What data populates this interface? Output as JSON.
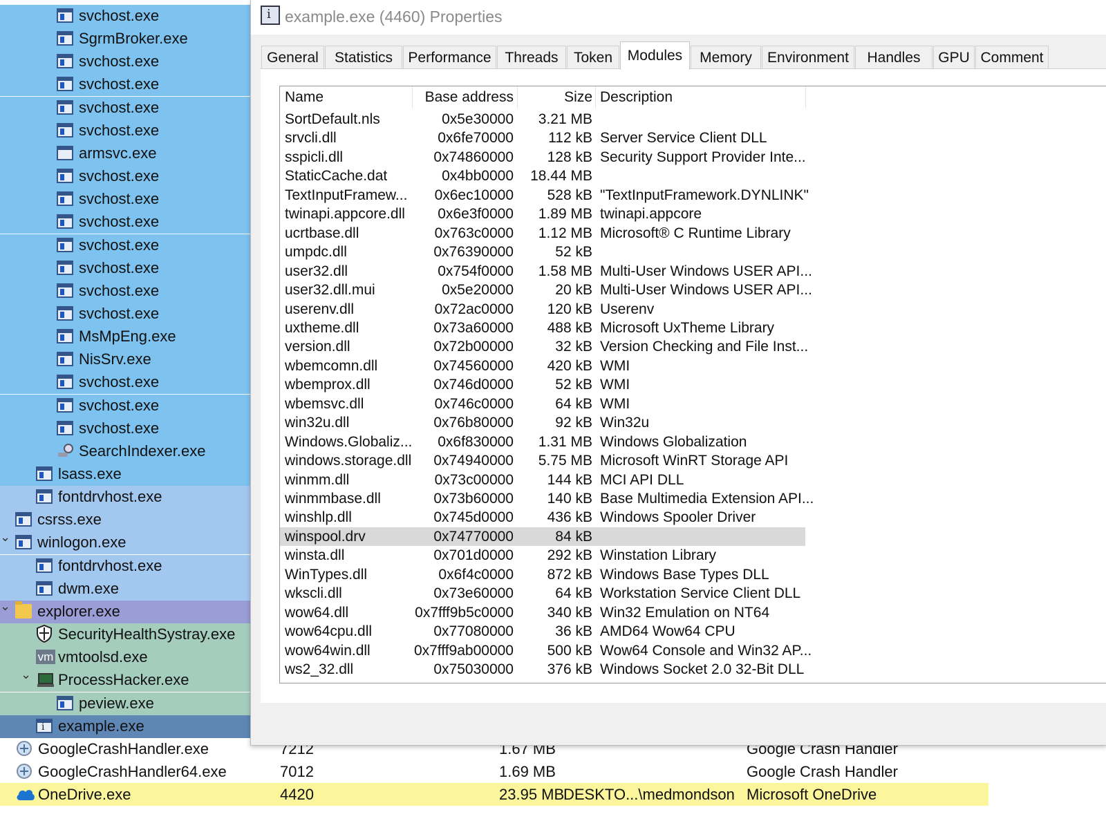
{
  "tree": [
    {
      "label": "svchost.exe",
      "indent": 2,
      "icon": "window-icon",
      "bg": "svc"
    },
    {
      "label": "SgrmBroker.exe",
      "indent": 2,
      "icon": "window-icon",
      "bg": "svc"
    },
    {
      "label": "svchost.exe",
      "indent": 2,
      "icon": "window-icon",
      "bg": "svc"
    },
    {
      "label": "svchost.exe",
      "indent": 2,
      "icon": "window-icon",
      "bg": "svc"
    },
    {
      "label": "svchost.exe",
      "indent": 2,
      "icon": "window-icon",
      "bg": "svc"
    },
    {
      "label": "svchost.exe",
      "indent": 2,
      "icon": "window-icon",
      "bg": "svc"
    },
    {
      "label": "armsvc.exe",
      "indent": 2,
      "icon": "blank-window-icon",
      "bg": "svc"
    },
    {
      "label": "svchost.exe",
      "indent": 2,
      "icon": "window-icon",
      "bg": "svc"
    },
    {
      "label": "svchost.exe",
      "indent": 2,
      "icon": "window-icon",
      "bg": "svc"
    },
    {
      "label": "svchost.exe",
      "indent": 2,
      "icon": "window-icon",
      "bg": "svc"
    },
    {
      "label": "svchost.exe",
      "indent": 2,
      "icon": "window-icon",
      "bg": "svc"
    },
    {
      "label": "svchost.exe",
      "indent": 2,
      "icon": "window-icon",
      "bg": "svc"
    },
    {
      "label": "svchost.exe",
      "indent": 2,
      "icon": "window-icon",
      "bg": "svc"
    },
    {
      "label": "svchost.exe",
      "indent": 2,
      "icon": "window-icon",
      "bg": "svc"
    },
    {
      "label": "MsMpEng.exe",
      "indent": 2,
      "icon": "window-icon",
      "bg": "svc"
    },
    {
      "label": "NisSrv.exe",
      "indent": 2,
      "icon": "window-icon",
      "bg": "svc"
    },
    {
      "label": "svchost.exe",
      "indent": 2,
      "icon": "window-icon",
      "bg": "svc"
    },
    {
      "label": "svchost.exe",
      "indent": 2,
      "icon": "window-icon",
      "bg": "svc"
    },
    {
      "label": "svchost.exe",
      "indent": 2,
      "icon": "window-icon",
      "bg": "svc"
    },
    {
      "label": "SearchIndexer.exe",
      "indent": 2,
      "icon": "search-indexer-icon",
      "bg": "svc"
    },
    {
      "label": "lsass.exe",
      "indent": 1,
      "icon": "window-icon",
      "bg": "svc"
    },
    {
      "label": "fontdrvhost.exe",
      "indent": 1,
      "icon": "window-icon",
      "bg": "sys"
    },
    {
      "label": "csrss.exe",
      "indent": 0,
      "icon": "window-icon",
      "bg": "sys"
    },
    {
      "label": "winlogon.exe",
      "indent": 0,
      "icon": "window-icon",
      "bg": "sys",
      "expand": "⌄"
    },
    {
      "label": "fontdrvhost.exe",
      "indent": 1,
      "icon": "window-icon",
      "bg": "sys"
    },
    {
      "label": "dwm.exe",
      "indent": 1,
      "icon": "window-icon",
      "bg": "sys"
    },
    {
      "label": "explorer.exe",
      "indent": 0,
      "icon": "folder-icon",
      "bg": "exp",
      "expand": "⌄"
    },
    {
      "label": "SecurityHealthSystray.exe",
      "indent": 1,
      "icon": "shield-icon",
      "bg": "usr"
    },
    {
      "label": "vmtoolsd.exe",
      "indent": 1,
      "icon": "vm-icon",
      "bg": "usr"
    },
    {
      "label": "ProcessHacker.exe",
      "indent": 1,
      "icon": "process-hacker-icon",
      "bg": "usr",
      "expand": "⌄"
    },
    {
      "label": "peview.exe",
      "indent": 2,
      "icon": "window-icon",
      "bg": "usr"
    },
    {
      "label": "example.exe",
      "indent": 1,
      "icon": "info-window-icon",
      "bg": "sel"
    }
  ],
  "main_rows": [
    {
      "name": "GoogleCrashHandler.exe",
      "pid": "7212",
      "mem": "1.67 MB",
      "user": "",
      "desc": "Google Crash Handler",
      "icon": "google-update-icon"
    },
    {
      "name": "GoogleCrashHandler64.exe",
      "pid": "7012",
      "mem": "1.69 MB",
      "user": "",
      "desc": "Google Crash Handler",
      "icon": "google-update-icon"
    },
    {
      "name": "OneDrive.exe",
      "pid": "4420",
      "mem": "23.95 MB",
      "user": "DESKTO...\\medmondson",
      "desc": "Microsoft OneDrive",
      "icon": "onedrive-icon",
      "highlight": true
    }
  ],
  "dialog": {
    "title": "example.exe (4460) Properties",
    "tabs": [
      "General",
      "Statistics",
      "Performance",
      "Threads",
      "Token",
      "Modules",
      "Memory",
      "Environment",
      "Handles",
      "GPU",
      "Comment"
    ],
    "active_tab": "Modules",
    "columns": {
      "name": "Name",
      "base": "Base address",
      "size": "Size",
      "desc": "Description"
    },
    "modules": [
      {
        "name": "SortDefault.nls",
        "base": "0x5e30000",
        "size": "3.21 MB",
        "desc": ""
      },
      {
        "name": "srvcli.dll",
        "base": "0x6fe70000",
        "size": "112 kB",
        "desc": "Server Service Client DLL"
      },
      {
        "name": "sspicli.dll",
        "base": "0x74860000",
        "size": "128 kB",
        "desc": "Security Support Provider Inte..."
      },
      {
        "name": "StaticCache.dat",
        "base": "0x4bb0000",
        "size": "18.44 MB",
        "desc": ""
      },
      {
        "name": "TextInputFramew...",
        "base": "0x6ec10000",
        "size": "528 kB",
        "desc": "\"TextInputFramework.DYNLINK\""
      },
      {
        "name": "twinapi.appcore.dll",
        "base": "0x6e3f0000",
        "size": "1.89 MB",
        "desc": "twinapi.appcore"
      },
      {
        "name": "ucrtbase.dll",
        "base": "0x763c0000",
        "size": "1.12 MB",
        "desc": "Microsoft® C Runtime Library"
      },
      {
        "name": "umpdc.dll",
        "base": "0x76390000",
        "size": "52 kB",
        "desc": ""
      },
      {
        "name": "user32.dll",
        "base": "0x754f0000",
        "size": "1.58 MB",
        "desc": "Multi-User Windows USER API..."
      },
      {
        "name": "user32.dll.mui",
        "base": "0x5e20000",
        "size": "20 kB",
        "desc": "Multi-User Windows USER API..."
      },
      {
        "name": "userenv.dll",
        "base": "0x72ac0000",
        "size": "120 kB",
        "desc": "Userenv"
      },
      {
        "name": "uxtheme.dll",
        "base": "0x73a60000",
        "size": "488 kB",
        "desc": "Microsoft UxTheme Library"
      },
      {
        "name": "version.dll",
        "base": "0x72b00000",
        "size": "32 kB",
        "desc": "Version Checking and File Inst..."
      },
      {
        "name": "wbemcomn.dll",
        "base": "0x74560000",
        "size": "420 kB",
        "desc": "WMI"
      },
      {
        "name": "wbemprox.dll",
        "base": "0x746d0000",
        "size": "52 kB",
        "desc": "WMI"
      },
      {
        "name": "wbemsvc.dll",
        "base": "0x746c0000",
        "size": "64 kB",
        "desc": "WMI"
      },
      {
        "name": "win32u.dll",
        "base": "0x76b80000",
        "size": "92 kB",
        "desc": "Win32u"
      },
      {
        "name": "Windows.Globaliz...",
        "base": "0x6f830000",
        "size": "1.31 MB",
        "desc": "Windows Globalization"
      },
      {
        "name": "windows.storage.dll",
        "base": "0x74940000",
        "size": "5.75 MB",
        "desc": "Microsoft WinRT Storage API"
      },
      {
        "name": "winmm.dll",
        "base": "0x73c00000",
        "size": "144 kB",
        "desc": "MCI API DLL"
      },
      {
        "name": "winmmbase.dll",
        "base": "0x73b60000",
        "size": "140 kB",
        "desc": "Base Multimedia Extension API..."
      },
      {
        "name": "winshlp.dll",
        "base": "0x745d0000",
        "size": "436 kB",
        "desc": "Windows Spooler Driver"
      },
      {
        "name": "winspool.drv",
        "base": "0x74770000",
        "size": "84 kB",
        "desc": "",
        "selected": true
      },
      {
        "name": "winsta.dll",
        "base": "0x701d0000",
        "size": "292 kB",
        "desc": "Winstation Library"
      },
      {
        "name": "WinTypes.dll",
        "base": "0x6f4c0000",
        "size": "872 kB",
        "desc": "Windows Base Types DLL"
      },
      {
        "name": "wkscli.dll",
        "base": "0x73e60000",
        "size": "64 kB",
        "desc": "Workstation Service Client DLL"
      },
      {
        "name": "wow64.dll",
        "base": "0x7fff9b5c0000",
        "size": "340 kB",
        "desc": "Win32 Emulation on NT64"
      },
      {
        "name": "wow64cpu.dll",
        "base": "0x77080000",
        "size": "36 kB",
        "desc": "AMD64 Wow64 CPU"
      },
      {
        "name": "wow64win.dll",
        "base": "0x7fff9ab00000",
        "size": "500 kB",
        "desc": "Wow64 Console and Win32 AP..."
      },
      {
        "name": "ws2_32.dll",
        "base": "0x75030000",
        "size": "376 kB",
        "desc": "Windows Socket 2.0 32-Bit DLL"
      }
    ]
  }
}
